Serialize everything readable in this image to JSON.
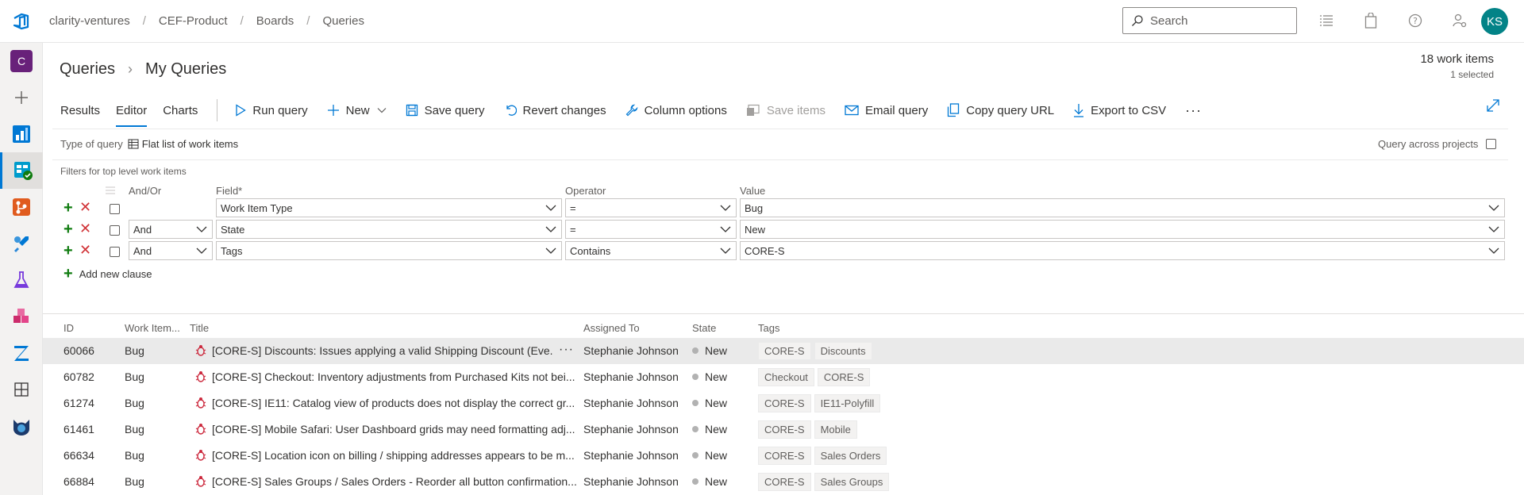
{
  "breadcrumb": [
    "clarity-ventures",
    "CEF-Product",
    "Boards",
    "Queries"
  ],
  "search": {
    "placeholder": "Search"
  },
  "avatar": {
    "initials": "KS"
  },
  "rail": {
    "org_initial": "C"
  },
  "page": {
    "title_root": "Queries",
    "title_current": "My Queries"
  },
  "count": {
    "items": "18 work items",
    "selected": "1 selected"
  },
  "tabs": [
    "Results",
    "Editor",
    "Charts"
  ],
  "active_tab": "Editor",
  "commands": {
    "run": "Run query",
    "new": "New",
    "save": "Save query",
    "revert": "Revert changes",
    "columns": "Column options",
    "save_items": "Save items",
    "email": "Email query",
    "copy_url": "Copy query URL",
    "export": "Export to CSV",
    "more": "···"
  },
  "query_type": {
    "label": "Type of query",
    "value": "Flat list of work items"
  },
  "query_across": "Query across projects",
  "filters_title": "Filters for top level work items",
  "clause_headers": {
    "andor": "And/Or",
    "field": "Field*",
    "operator": "Operator",
    "value": "Value"
  },
  "clauses": [
    {
      "andor": "",
      "field": "Work Item Type",
      "operator": "=",
      "value": "Bug"
    },
    {
      "andor": "And",
      "field": "State",
      "operator": "=",
      "value": "New"
    },
    {
      "andor": "And",
      "field": "Tags",
      "operator": "Contains",
      "value": "CORE-S"
    }
  ],
  "add_clause": "Add new clause",
  "result_headers": {
    "id": "ID",
    "type": "Work Item...",
    "title": "Title",
    "assigned": "Assigned To",
    "state": "State",
    "tags": "Tags"
  },
  "rows": [
    {
      "id": "60066",
      "type": "Bug",
      "title": "[CORE-S] Discounts: Issues applying a valid Shipping Discount (Eve...",
      "assigned": "Stephanie Johnson",
      "state": "New",
      "tags": [
        "CORE-S",
        "Discounts"
      ],
      "more": "···"
    },
    {
      "id": "60782",
      "type": "Bug",
      "title": "[CORE-S] Checkout: Inventory adjustments from Purchased Kits not bei...",
      "assigned": "Stephanie Johnson",
      "state": "New",
      "tags": [
        "Checkout",
        "CORE-S"
      ]
    },
    {
      "id": "61274",
      "type": "Bug",
      "title": "[CORE-S] IE11: Catalog view of products does not display the correct gr...",
      "assigned": "Stephanie Johnson",
      "state": "New",
      "tags": [
        "CORE-S",
        "IE11-Polyfill"
      ]
    },
    {
      "id": "61461",
      "type": "Bug",
      "title": "[CORE-S] Mobile Safari: User Dashboard grids may need formatting adj...",
      "assigned": "Stephanie Johnson",
      "state": "New",
      "tags": [
        "CORE-S",
        "Mobile"
      ]
    },
    {
      "id": "66634",
      "type": "Bug",
      "title": "[CORE-S] Location icon on billing / shipping addresses appears to be m...",
      "assigned": "Stephanie Johnson",
      "state": "New",
      "tags": [
        "CORE-S",
        "Sales Orders"
      ]
    },
    {
      "id": "66884",
      "type": "Bug",
      "title": "[CORE-S] Sales Groups / Sales Orders - Reorder all button confirmation...",
      "assigned": "Stephanie Johnson",
      "state": "New",
      "tags": [
        "CORE-S",
        "Sales Groups"
      ]
    }
  ]
}
